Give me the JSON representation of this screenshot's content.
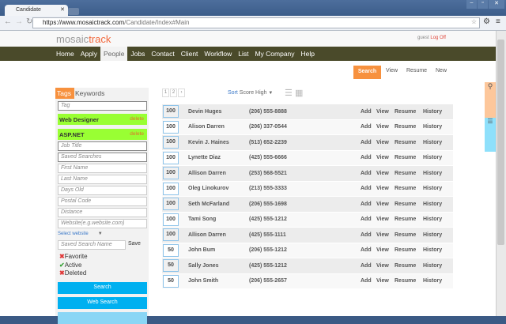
{
  "browser": {
    "tab_title": "Candidate",
    "url_host": "https://www.mosaictrack.com",
    "url_path": "/Candidate/Index#Main"
  },
  "header": {
    "logo_a": "mosaic",
    "logo_b": "track",
    "user": "guest",
    "logoff": "Log Off"
  },
  "nav": [
    "Home",
    "Apply",
    "People",
    "Jobs",
    "Contact",
    "Client",
    "Workflow",
    "List",
    "My Company",
    "Help"
  ],
  "actions": {
    "search": "Search",
    "view": "View",
    "resume": "Resume",
    "new": "New"
  },
  "filters": {
    "tab_tags": "Tags",
    "tab_keywords": "Keywords",
    "tag_placeholder": "Tag",
    "tags": [
      {
        "label": "Web Designer",
        "delete": "delete"
      },
      {
        "label": "ASP.NET",
        "delete": "delete"
      }
    ],
    "fields": [
      "Job Title",
      "Saved Searches",
      "First Name",
      "Last Name",
      "Days Old",
      "Postal Code",
      "Distance",
      "Website(e.g.website.com)"
    ],
    "select_website": "Select website",
    "saved_search_name": "Saved Search Name",
    "save": "Save",
    "checks": [
      {
        "label": "Favorite",
        "state": "x"
      },
      {
        "label": "Active",
        "state": "check"
      },
      {
        "label": "Deleted",
        "state": "x"
      }
    ],
    "search_btn": "Search",
    "web_search_btn": "Web Search"
  },
  "results": {
    "pages": [
      "1",
      "2",
      "›"
    ],
    "sort_label": "Sort",
    "sort_value": "Score High",
    "row_actions": [
      "Add",
      "View",
      "Resume",
      "History"
    ],
    "rows": [
      {
        "score": "100",
        "name": "Devin Huges",
        "phone": "(206) 555-8888"
      },
      {
        "score": "100",
        "name": "Alison Darren",
        "phone": "(206) 337-0544"
      },
      {
        "score": "100",
        "name": "Kevin J. Haines",
        "phone": "(513) 652-2239"
      },
      {
        "score": "100",
        "name": "Lynette Diaz",
        "phone": "(425) 555-6666"
      },
      {
        "score": "100",
        "name": "Allison Darren",
        "phone": "(253) 568-5521"
      },
      {
        "score": "100",
        "name": "Oleg Linokurov",
        "phone": "(213) 555-3333"
      },
      {
        "score": "100",
        "name": "Seth McFarland",
        "phone": "(206) 555-1698"
      },
      {
        "score": "100",
        "name": "Tami Song",
        "phone": "(425) 555-1212"
      },
      {
        "score": "100",
        "name": "Allison Darren",
        "phone": "(425) 555-1111"
      },
      {
        "score": "50",
        "name": "John Bum",
        "phone": "(206) 555-1212"
      },
      {
        "score": "50",
        "name": "Sally Jones",
        "phone": "(425) 555-1212"
      },
      {
        "score": "50",
        "name": "John Smith",
        "phone": "(206) 555-2657"
      }
    ]
  }
}
